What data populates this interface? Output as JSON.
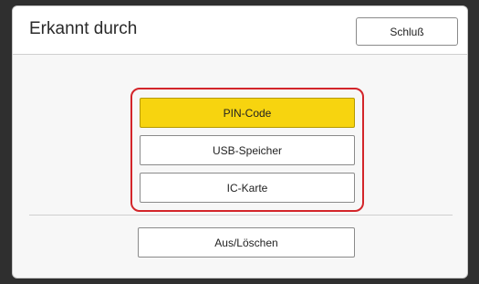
{
  "dialog": {
    "title": "Erkannt durch",
    "close_label": "Schluß"
  },
  "options": [
    {
      "label": "PIN-Code",
      "selected": true
    },
    {
      "label": "USB-Speicher",
      "selected": false
    },
    {
      "label": "IC-Karte",
      "selected": false
    }
  ],
  "footer": {
    "off_label": "Aus/Löschen"
  },
  "colors": {
    "selected_fill": "#f7d40f",
    "highlight_border": "#d3252a"
  }
}
